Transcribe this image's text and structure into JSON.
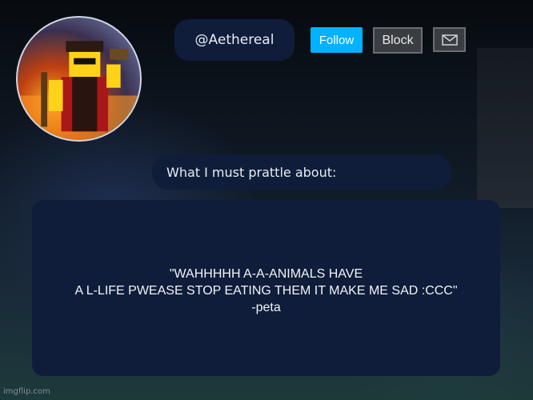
{
  "profile": {
    "username": "@Aethereal"
  },
  "actions": {
    "follow_label": "Follow",
    "block_label": "Block",
    "message_icon": "mail-icon"
  },
  "about": {
    "label": "What I must prattle about:",
    "lines": [
      "\"WAHHHHH A-A-ANIMALS HAVE",
      "A L-LIFE PWEASE STOP EATING THEM IT MAKE ME SAD :CCC\"",
      "-peta"
    ]
  },
  "watermark": "imgflip.com",
  "colors": {
    "pill": "#0f1d3a",
    "follow": "#00b2ff",
    "block": "#3a3d42"
  }
}
